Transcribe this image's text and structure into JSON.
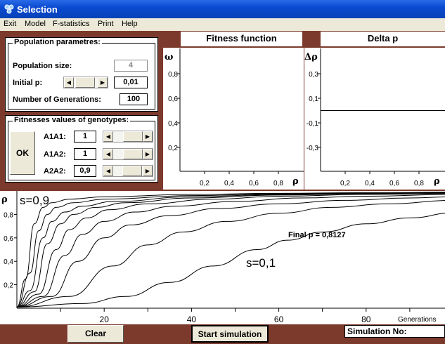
{
  "window": {
    "title": "Selection"
  },
  "menu": {
    "items": [
      "Exit",
      "Model",
      "F-statistics",
      "Print",
      "Help"
    ]
  },
  "population": {
    "title": "Population parametres:",
    "size_label": "Population size:",
    "size_value": "4",
    "initial_p_label": "Initial p:",
    "initial_p_value": "0,01",
    "generations_label": "Number of Generations:",
    "generations_value": "100"
  },
  "fitnesses": {
    "title": "Fitnesses values of genotypes:",
    "ok_label": "OK",
    "rows": [
      {
        "label": "A1A1:",
        "value": "1",
        "slider_level": 1.0
      },
      {
        "label": "A1A2:",
        "value": "1",
        "slider_level": 1.0
      },
      {
        "label": "A2A2:",
        "value": "0,9",
        "slider_level": 0.9
      }
    ]
  },
  "fitness_chart": {
    "title": "Fitness function",
    "y_symbol": "ω",
    "x_symbol": "ρ",
    "y_ticks": [
      "0,8",
      "0,6",
      "0,4",
      "0,2"
    ],
    "x_ticks": [
      "0,2",
      "0,4",
      "0,6",
      "0,8"
    ]
  },
  "delta_chart": {
    "title": "Delta p",
    "y_symbol": "Δρ",
    "x_symbol": "ρ",
    "y_ticks": [
      "0,3",
      "0,1",
      "-0,1",
      "-0,3"
    ],
    "x_ticks": [
      "0,2",
      "0,4",
      "0,6",
      "0,8"
    ],
    "zero_line": 0
  },
  "chart_data": {
    "type": "line",
    "title": "",
    "xlabel": "Generations",
    "ylabel": "ρ",
    "xlim": [
      0,
      100
    ],
    "ylim": [
      0,
      1
    ],
    "x_ticks": [
      "20",
      "40",
      "60",
      "80"
    ],
    "y_ticks": [
      "0,8",
      "0,6",
      "0,4",
      "0,2"
    ],
    "annotations": [
      "s=0,9",
      "s=0,1",
      "Final p = 0,8127"
    ],
    "series": [
      {
        "s": 0.9,
        "x": [
          0,
          2,
          4,
          6,
          8,
          12,
          20,
          40,
          60,
          80,
          100
        ],
        "values": [
          0.01,
          0.25,
          0.72,
          0.86,
          0.9,
          0.93,
          0.95,
          0.97,
          0.98,
          0.985,
          0.99
        ]
      },
      {
        "s": 0.8,
        "x": [
          0,
          3,
          5,
          7,
          9,
          13,
          20,
          40,
          60,
          80,
          100
        ],
        "values": [
          0.01,
          0.3,
          0.66,
          0.8,
          0.86,
          0.9,
          0.93,
          0.96,
          0.975,
          0.982,
          0.988
        ]
      },
      {
        "s": 0.7,
        "x": [
          0,
          3,
          6,
          8,
          11,
          15,
          22,
          40,
          60,
          80,
          100
        ],
        "values": [
          0.01,
          0.15,
          0.6,
          0.74,
          0.82,
          0.87,
          0.91,
          0.95,
          0.97,
          0.98,
          0.985
        ]
      },
      {
        "s": 0.6,
        "x": [
          0,
          4,
          7,
          10,
          13,
          18,
          25,
          40,
          60,
          80,
          100
        ],
        "values": [
          0.01,
          0.14,
          0.55,
          0.72,
          0.8,
          0.86,
          0.9,
          0.94,
          0.965,
          0.977,
          0.983
        ]
      },
      {
        "s": 0.5,
        "x": [
          0,
          5,
          9,
          12,
          16,
          21,
          30,
          45,
          60,
          80,
          100
        ],
        "values": [
          0.01,
          0.12,
          0.5,
          0.67,
          0.77,
          0.84,
          0.89,
          0.93,
          0.955,
          0.97,
          0.978
        ]
      },
      {
        "s": 0.4,
        "x": [
          0,
          6,
          11,
          15,
          20,
          27,
          36,
          50,
          65,
          80,
          100
        ],
        "values": [
          0.01,
          0.1,
          0.45,
          0.63,
          0.74,
          0.82,
          0.87,
          0.91,
          0.94,
          0.955,
          0.97
        ]
      },
      {
        "s": 0.3,
        "x": [
          0,
          8,
          14,
          20,
          26,
          35,
          46,
          60,
          75,
          90,
          100
        ],
        "values": [
          0.01,
          0.1,
          0.4,
          0.6,
          0.71,
          0.79,
          0.85,
          0.89,
          0.92,
          0.94,
          0.95
        ]
      },
      {
        "s": 0.2,
        "x": [
          0,
          12,
          22,
          30,
          38,
          48,
          60,
          72,
          85,
          100
        ],
        "values": [
          0.01,
          0.1,
          0.36,
          0.54,
          0.65,
          0.74,
          0.81,
          0.86,
          0.89,
          0.92
        ]
      },
      {
        "s": 0.1,
        "x": [
          0,
          15,
          25,
          35,
          45,
          55,
          62,
          70,
          80,
          90,
          100
        ],
        "values": [
          0.01,
          0.04,
          0.1,
          0.22,
          0.36,
          0.5,
          0.58,
          0.65,
          0.72,
          0.77,
          0.8127
        ]
      }
    ]
  },
  "footer": {
    "clear_label": "Clear",
    "start_label": "Start simulation",
    "simulation_no_label": "Simulation No:"
  }
}
